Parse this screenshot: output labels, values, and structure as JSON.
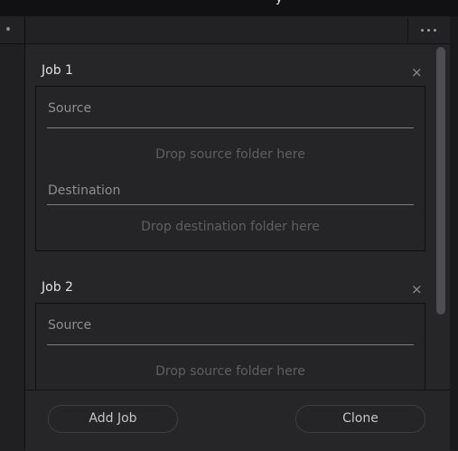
{
  "header": {
    "title_partial": "y",
    "menu_icon": "more-horizontal-icon"
  },
  "jobs": [
    {
      "title": "Job 1",
      "source": {
        "label": "Source",
        "drop_text": "Drop source folder here"
      },
      "destination": {
        "label": "Destination",
        "drop_text": "Drop destination folder here"
      },
      "close_glyph": "×"
    },
    {
      "title": "Job 2",
      "source": {
        "label": "Source",
        "drop_text": "Drop source folder here"
      },
      "close_glyph": "×"
    }
  ],
  "footer": {
    "add_job_label": "Add Job",
    "clone_label": "Clone"
  }
}
